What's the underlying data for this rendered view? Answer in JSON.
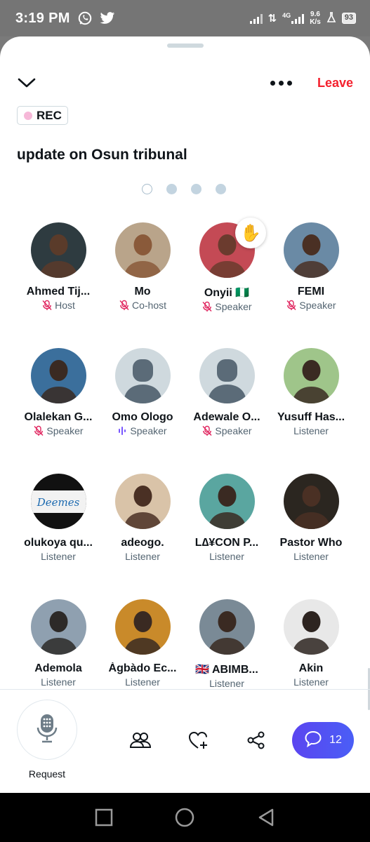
{
  "status_bar": {
    "time": "3:19 PM",
    "network": "4G",
    "speed_value": "9.6",
    "speed_unit": "K/s",
    "battery": "93"
  },
  "space": {
    "rec_label": "REC",
    "title": "update on Osun tribunal",
    "leave_label": "Leave",
    "pages": 4,
    "active_page": 1
  },
  "participants": [
    {
      "name": "Ahmed Tij...",
      "role": "Host",
      "mic": "muted",
      "bg": "#2e3b40",
      "face": "#5a3b2a"
    },
    {
      "name": "Mo",
      "role": "Co-host",
      "mic": "muted",
      "bg": "#b9a48a",
      "face": "#8a5a3a"
    },
    {
      "name": "Onyii 🇳🇬",
      "role": "Speaker",
      "mic": "muted",
      "bg": "#c44a55",
      "face": "#6b3b2e",
      "hand": "✋"
    },
    {
      "name": "FEMI",
      "role": "Speaker",
      "mic": "muted",
      "bg": "#6a8aa5",
      "face": "#4a3024"
    },
    {
      "name": "Olalekan G...",
      "role": "Speaker",
      "mic": "muted",
      "bg": "#3b6f9c",
      "face": "#3a2a22"
    },
    {
      "name": "Omo Ologo",
      "role": "Speaker",
      "mic": "speaking",
      "bg": "#cfd9de",
      "face": "default"
    },
    {
      "name": "Adewale O...",
      "role": "Speaker",
      "mic": "muted",
      "bg": "#cfd9de",
      "face": "default"
    },
    {
      "name": "Yusuff Has...",
      "role": "Listener",
      "mic": "none",
      "bg": "#9fc58a",
      "face": "#3a2a22"
    },
    {
      "name": "olukoya qu...",
      "role": "Listener",
      "mic": "none",
      "bg": "#1a1a1a",
      "face": "logo"
    },
    {
      "name": "adeogo.",
      "role": "Listener",
      "mic": "none",
      "bg": "#d9c3a8",
      "face": "#4a3024"
    },
    {
      "name": "L∆¥CON P...",
      "role": "Listener",
      "mic": "none",
      "bg": "#5aa6a0",
      "face": "#3a2a22"
    },
    {
      "name": "Pastor Who",
      "role": "Listener",
      "mic": "none",
      "bg": "#2b2620",
      "face": "#4a3024"
    },
    {
      "name": "Ademola",
      "role": "Listener",
      "mic": "none",
      "bg": "#8fa0b0",
      "face": "#2d2a28"
    },
    {
      "name": "Àgbàdo Ec...",
      "role": "Listener",
      "mic": "none",
      "bg": "#c98a2a",
      "face": "#3a2a22"
    },
    {
      "name": "🇬🇧 ABIMB...",
      "role": "Listener",
      "mic": "none",
      "bg": "#7a8a96",
      "face": "#3a2a22"
    },
    {
      "name": "Akin",
      "role": "Listener",
      "mic": "none",
      "bg": "#e8e8e8",
      "face": "#2d2420"
    }
  ],
  "bottom_bar": {
    "request_label": "Request",
    "chat_count": "12"
  },
  "colors": {
    "leave": "#f4212e",
    "rec_dot": "#f6b8d8",
    "muted_icon": "#e0245e",
    "speaking_icon": "#7856ff",
    "chat_button": "#5b45f0"
  }
}
